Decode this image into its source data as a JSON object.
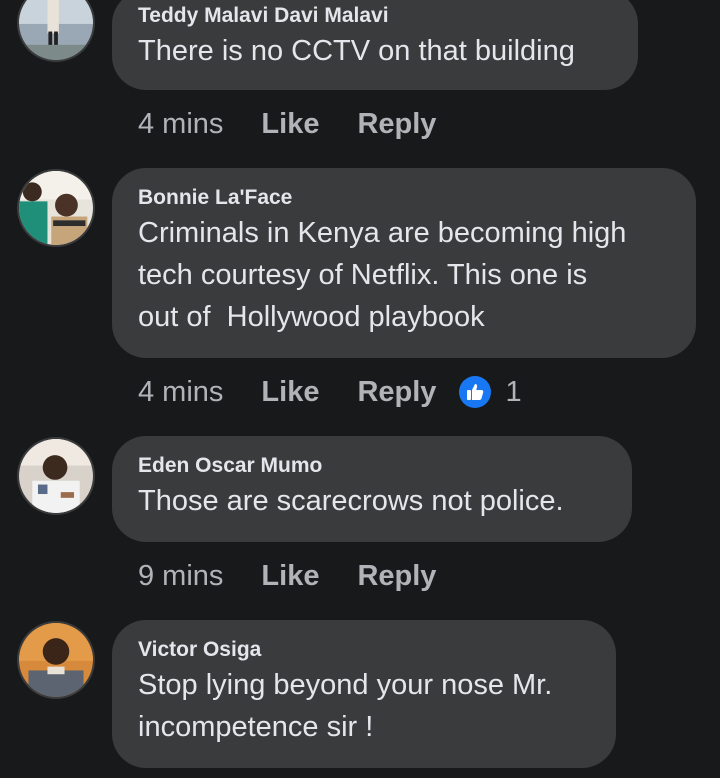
{
  "colors": {
    "background": "#18191a",
    "bubble": "#3a3b3c",
    "text_primary": "#e4e6eb",
    "text_secondary": "#b0b3b8",
    "like_blue": "#1877f2"
  },
  "comments": [
    {
      "author": "Teddy Malavi Davi Malavi",
      "text": "There is no CCTV on that building",
      "time": "4 mins",
      "like_label": "Like",
      "reply_label": "Reply"
    },
    {
      "author": "Bonnie La'Face",
      "text": "Criminals in Kenya are becoming high\ntech courtesy of Netflix. This one is\nout of  Hollywood playbook",
      "time": "4 mins",
      "like_label": "Like",
      "reply_label": "Reply",
      "reaction_icon": "thumbs-up-icon",
      "reaction_count": "1"
    },
    {
      "author": "Eden Oscar Mumo",
      "text": "Those are scarecrows not police.",
      "time": "9 mins",
      "like_label": "Like",
      "reply_label": "Reply"
    },
    {
      "author": "Victor Osiga",
      "text": "Stop lying beyond your nose Mr.\nincompetence sir !",
      "time": "",
      "like_label": "",
      "reply_label": ""
    }
  ]
}
